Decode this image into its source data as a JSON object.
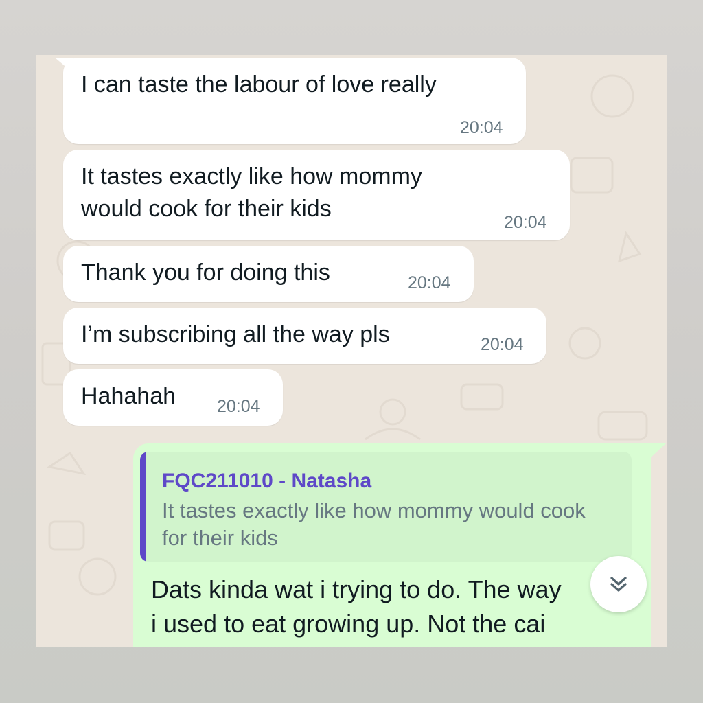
{
  "messages_in": [
    {
      "text_lines": [
        "I can taste the labour of love really"
      ],
      "time": "20:04"
    },
    {
      "text_lines": [
        "It tastes exactly like how mommy",
        "would cook for their kids"
      ],
      "time": "20:04"
    },
    {
      "text_lines": [
        "Thank you for doing this"
      ],
      "time": "20:04"
    },
    {
      "text_lines": [
        "I’m subscribing all the way pls"
      ],
      "time": "20:04"
    },
    {
      "text_lines": [
        "Hahahah"
      ],
      "time": "20:04"
    }
  ],
  "reply": {
    "quoted_sender": "FQC211010 - Natasha",
    "quoted_text": "It tastes exactly like how mommy would cook for their kids",
    "text_line1": "Dats kinda wat i trying to do. The way",
    "text_line2": "i used to eat growing up. Not the cai"
  },
  "scroll_button": {
    "icon": "double-chevron-down-icon"
  },
  "colors": {
    "chat_background": "#ece5dc",
    "incoming_bubble": "#ffffff",
    "outgoing_bubble": "#d9fdd3",
    "quote_accent": "#5e48c8",
    "timestamp": "#667781"
  }
}
